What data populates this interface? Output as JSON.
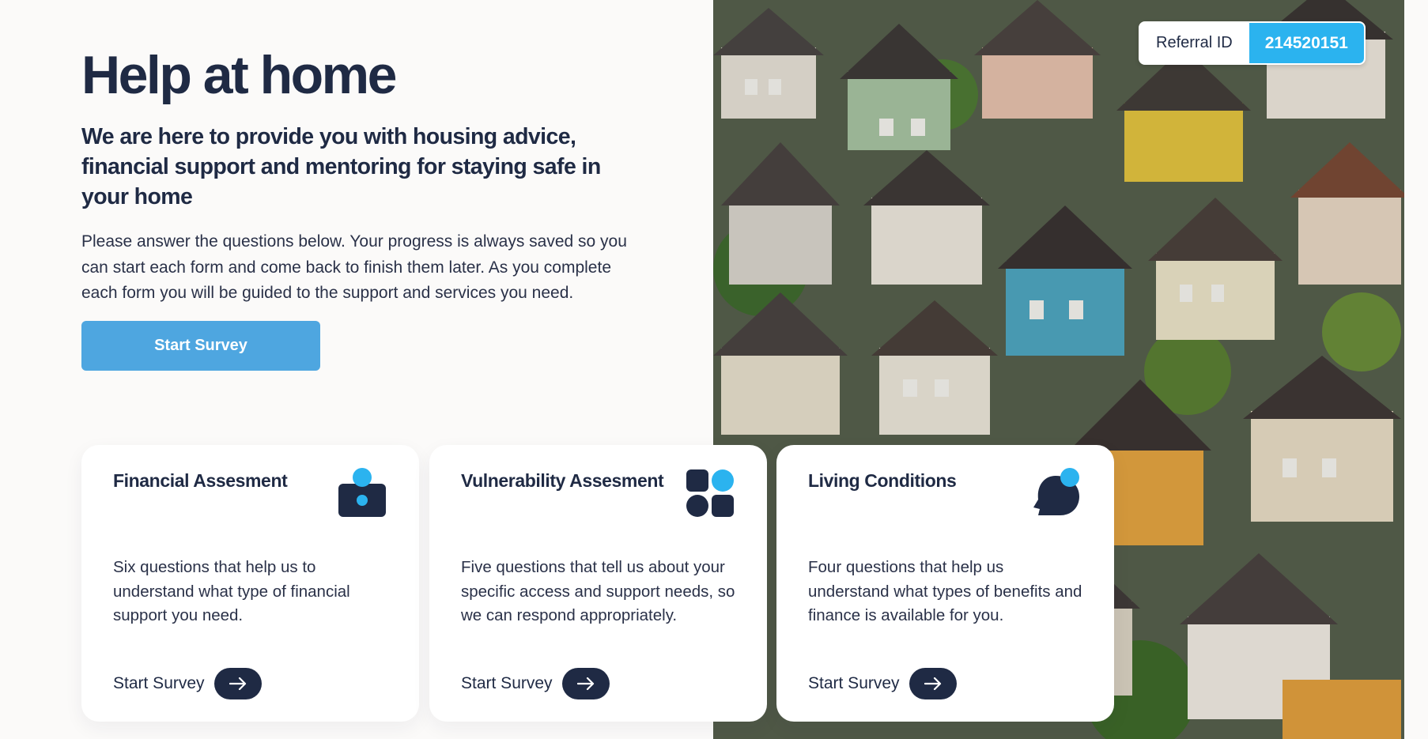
{
  "hero": {
    "title": "Help at home",
    "subtitle": "We are here to provide you with housing advice, financial support and mentoring for staying safe in your home",
    "body": "Please answer the questions below. Your progress is always saved so you can start each form and come back to finish them later. As you complete each form you will be guided to the support and services you need.",
    "cta_label": "Start Survey"
  },
  "referral": {
    "label": "Referral ID",
    "value": "214520151"
  },
  "cards": [
    {
      "title": "Financial Assesment",
      "description": "Six questions that help us to understand what type of financial support you need.",
      "link_label": "Start Survey",
      "icon": "wallet-icon"
    },
    {
      "title": "Vulnerability Assesment",
      "description": "Five questions that tell us about your specific access and support needs, so we can respond appropriately.",
      "link_label": "Start Survey",
      "icon": "grid-shapes-icon"
    },
    {
      "title": "Living Conditions",
      "description": "Four questions that help us understand what types of benefits and finance is available for you.",
      "link_label": "Start Survey",
      "icon": "head-profile-icon"
    }
  ],
  "colors": {
    "navy": "#1f2a44",
    "accent_blue": "#2bb3ef",
    "button_blue": "#4ea6e0",
    "background": "#fbfaf9"
  }
}
